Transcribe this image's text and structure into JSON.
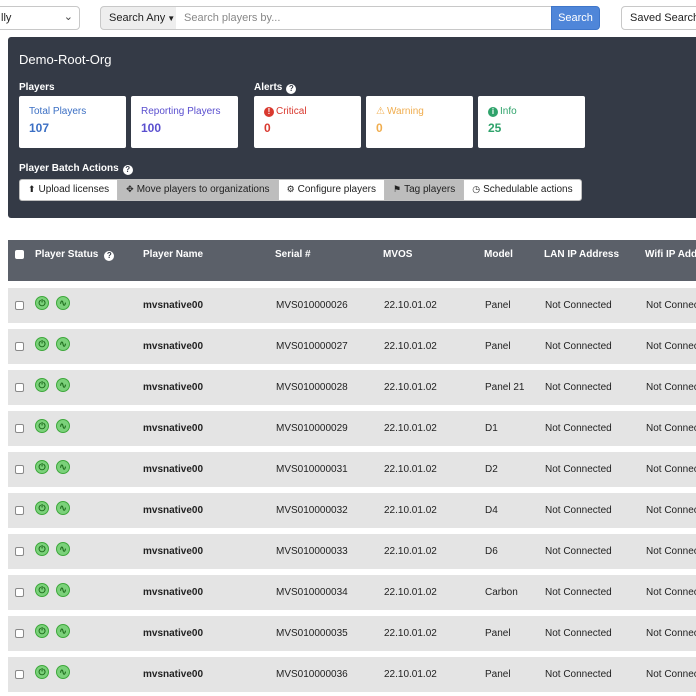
{
  "topbar": {
    "filter_dropdown": "lly",
    "search_mode": "Search Any",
    "search_placeholder": "Search players by...",
    "search_button": "Search",
    "saved_searches": "Saved Searches"
  },
  "panel": {
    "org_name": "Demo-Root-Org",
    "players_label": "Players",
    "alerts_label": "Alerts",
    "cards": {
      "total": {
        "label": "Total Players",
        "value": "107",
        "color": "#3b6fc4"
      },
      "reporting": {
        "label": "Reporting Players",
        "value": "100",
        "color": "#5a4fcf"
      },
      "critical": {
        "label": "Critical",
        "value": "0",
        "color": "#d9392f"
      },
      "warning": {
        "label": "Warning",
        "value": "0",
        "color": "#f0ad4e"
      },
      "info": {
        "label": "Info",
        "value": "25",
        "color": "#2fa36b"
      }
    },
    "batch_label": "Player Batch Actions",
    "batch_actions": [
      "Upload licenses",
      "Move players to organizations",
      "Configure players",
      "Tag players",
      "Schedulable actions"
    ]
  },
  "table": {
    "columns": [
      "Player Status",
      "Player Name",
      "Serial #",
      "MVOS",
      "Model",
      "LAN IP Address",
      "Wifi IP Address"
    ],
    "rows": [
      {
        "name": "mvsnative00",
        "serial": "MVS010000026",
        "mvos": "22.10.01.02",
        "model": "Panel",
        "lan": "Not Connected",
        "wifi": "Not Connected"
      },
      {
        "name": "mvsnative00",
        "serial": "MVS010000027",
        "mvos": "22.10.01.02",
        "model": "Panel",
        "lan": "Not Connected",
        "wifi": "Not Connected"
      },
      {
        "name": "mvsnative00",
        "serial": "MVS010000028",
        "mvos": "22.10.01.02",
        "model": "Panel 21",
        "lan": "Not Connected",
        "wifi": "Not Connected"
      },
      {
        "name": "mvsnative00",
        "serial": "MVS010000029",
        "mvos": "22.10.01.02",
        "model": "D1",
        "lan": "Not Connected",
        "wifi": "Not Connected"
      },
      {
        "name": "mvsnative00",
        "serial": "MVS010000031",
        "mvos": "22.10.01.02",
        "model": "D2",
        "lan": "Not Connected",
        "wifi": "Not Connected"
      },
      {
        "name": "mvsnative00",
        "serial": "MVS010000032",
        "mvos": "22.10.01.02",
        "model": "D4",
        "lan": "Not Connected",
        "wifi": "Not Connected"
      },
      {
        "name": "mvsnative00",
        "serial": "MVS010000033",
        "mvos": "22.10.01.02",
        "model": "D6",
        "lan": "Not Connected",
        "wifi": "Not Connected"
      },
      {
        "name": "mvsnative00",
        "serial": "MVS010000034",
        "mvos": "22.10.01.02",
        "model": "Carbon",
        "lan": "Not Connected",
        "wifi": "Not Connected"
      },
      {
        "name": "mvsnative00",
        "serial": "MVS010000035",
        "mvos": "22.10.01.02",
        "model": "Panel",
        "lan": "Not Connected",
        "wifi": "Not Connected"
      },
      {
        "name": "mvsnative00",
        "serial": "MVS010000036",
        "mvos": "22.10.01.02",
        "model": "Panel",
        "lan": "Not Connected",
        "wifi": "Not Connected"
      }
    ]
  }
}
